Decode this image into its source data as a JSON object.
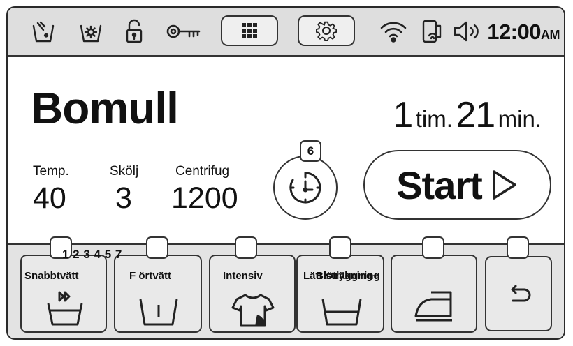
{
  "status_bar": {
    "icons": [
      "detergent-icon",
      "child-lock-icon",
      "unlocked-padlock-icon",
      "key-icon",
      "grid-menu-icon",
      "settings-gear-icon",
      "wifi-icon",
      "remote-control-icon",
      "speaker-icon"
    ],
    "clock_time": "12:00",
    "clock_ampm": "AM"
  },
  "program": {
    "name": "Bomull",
    "hours": "1",
    "hours_unit": "tim.",
    "minutes": "21",
    "minutes_unit": "min."
  },
  "params": [
    {
      "label": "Temp.",
      "value": "40"
    },
    {
      "label": "Skölj",
      "value": "3"
    },
    {
      "label": "Centrifug",
      "value": "1200"
    }
  ],
  "delay": {
    "badge": "6"
  },
  "start": {
    "label": "Start"
  },
  "options": {
    "checkbox_caption": "1 2 3 4 5 7",
    "items": [
      {
        "label": "Snabbtvätt",
        "icon": "quick-wash-icon"
      },
      {
        "label": "F       örtvätt",
        "icon": "prewash-icon"
      },
      {
        "label": "Intensiv",
        "icon": "intensive-shirt-icon"
      },
      {
        "label": "Lätt strykning+",
        "icon": "easy-iron-basin-icon"
      },
      {
        "label": "Blötläggning",
        "icon": "soak-basin-icon"
      },
      {
        "label": "",
        "icon": "iron-icon"
      },
      {
        "label": "",
        "icon": "back-arrow-icon"
      }
    ]
  },
  "colors": {
    "status_bg": "#dedede",
    "panel_bg": "#e3e3e3",
    "border": "#333333"
  }
}
